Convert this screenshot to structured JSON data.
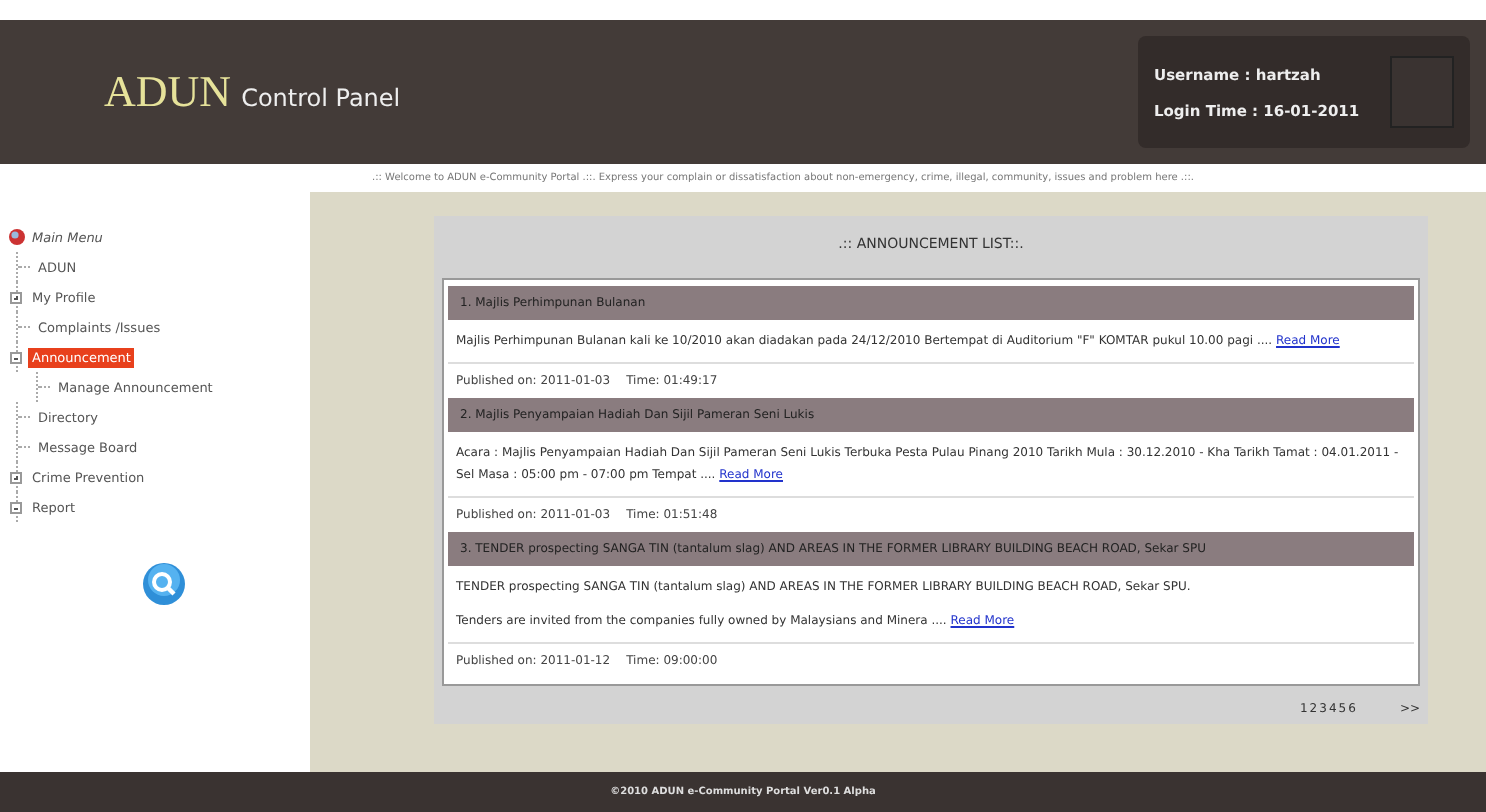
{
  "header": {
    "logo_main": "ADUN",
    "logo_sub": "Control Panel",
    "username": "Username : hartzah",
    "login_time": "Login Time : 16-01-2011"
  },
  "welcome": ".:: Welcome to ADUN e-Community Portal .::. Express your complain or dissatisfaction about non-emergency, crime, illegal, community, issues and problem here .::.",
  "sidebar": {
    "title": "Main Menu",
    "items": [
      {
        "label": "ADUN",
        "kind": "leaf",
        "selected": false
      },
      {
        "label": "My Profile",
        "kind": "folder",
        "expanded": false,
        "selected": false
      },
      {
        "label": "Complaints /Issues",
        "kind": "leaf",
        "selected": false
      },
      {
        "label": "Announcement",
        "kind": "folder",
        "expanded": true,
        "selected": true,
        "children": [
          {
            "label": "Manage Announcement",
            "kind": "leaf",
            "selected": false
          }
        ]
      },
      {
        "label": "Directory",
        "kind": "leaf",
        "selected": false
      },
      {
        "label": "Message Board",
        "kind": "leaf",
        "selected": false
      },
      {
        "label": "Crime Prevention",
        "kind": "folder",
        "expanded": false,
        "selected": false
      },
      {
        "label": "Report",
        "kind": "folder",
        "expanded": true,
        "selected": false
      }
    ]
  },
  "announcements": {
    "title": ".:: ANNOUNCEMENT LIST::.",
    "items": [
      {
        "title": "1. Majlis Perhimpunan Bulanan",
        "body": [
          "Majlis Perhimpunan Bulanan kali ke 10/2010 akan diadakan pada 24/12/2010 Bertempat di Auditorium \"F\" KOMTAR pukul 10.00 pagi ...."
        ],
        "link": "Read More",
        "published": "Published on: 2011-01-03",
        "time": "Time: 01:49:17"
      },
      {
        "title": "2. Majlis Penyampaian Hadiah Dan Sijil Pameran Seni Lukis",
        "body": [
          "Acara : Majlis Penyampaian Hadiah Dan Sijil Pameran Seni Lukis Terbuka Pesta Pulau Pinang 2010 Tarikh Mula : 30.12.2010 - Kha Tarikh Tamat : 04.01.2011 - Sel Masa : 05:00 pm - 07:00 pm Tempat ...."
        ],
        "link": "Read More",
        "published": "Published on: 2011-01-03",
        "time": "Time: 01:51:48"
      },
      {
        "title": "3. TENDER prospecting SANGA TIN (tantalum slag) AND AREAS IN THE FORMER LIBRARY BUILDING BEACH ROAD, Sekar SPU",
        "body": [
          "TENDER prospecting SANGA TIN (tantalum slag) AND AREAS IN THE FORMER LIBRARY BUILDING BEACH ROAD, Sekar SPU.",
          "Tenders are invited from the companies fully owned by Malaysians and Minera ...."
        ],
        "link": "Read More",
        "published": "Published on: 2011-01-12",
        "time": "Time: 09:00:00"
      }
    ],
    "pages": [
      "1",
      "2",
      "3",
      "4",
      "5",
      "6"
    ],
    "next": ">>"
  },
  "footer": "©2010 ADUN e-Community Portal Ver0.1 Alpha"
}
